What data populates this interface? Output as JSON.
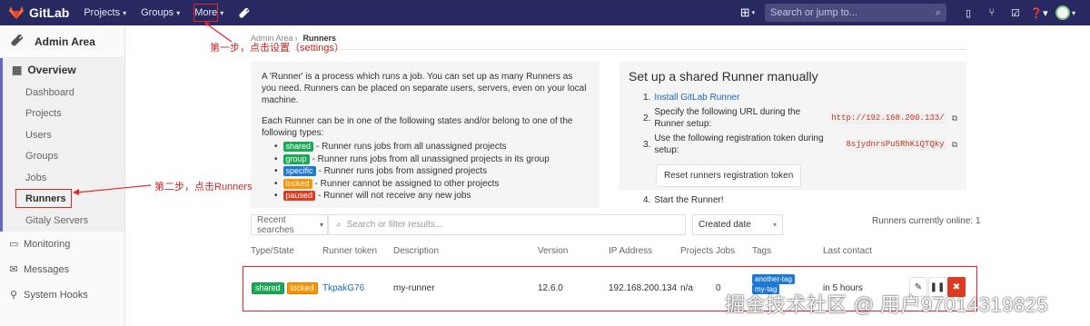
{
  "topnav": {
    "brand": "GitLab",
    "links": [
      "Projects",
      "Groups",
      "More"
    ],
    "search_placeholder": "Search or jump to...",
    "icons": [
      "wrench-icon",
      "plus-icon",
      "search-icon",
      "todo-sidebar-icon",
      "merge-request-icon",
      "issues-icon",
      "help-icon",
      "avatar"
    ]
  },
  "sidebar": {
    "header": "Admin Area",
    "overview": "Overview",
    "sub_items": [
      "Dashboard",
      "Projects",
      "Users",
      "Groups",
      "Jobs",
      "Runners",
      "Gitaly Servers"
    ],
    "active": "Runners",
    "items": [
      "Monitoring",
      "Messages",
      "System Hooks"
    ]
  },
  "breadcrumb": {
    "parent": "Admin Area",
    "current": "Runners"
  },
  "info": {
    "p1": "A 'Runner' is a process which runs a job. You can set up as many Runners as you need. Runners can be placed on separate users, servers, even on your local machine.",
    "p2": "Each Runner can be in one of the following states and/or belong to one of the following types:",
    "states": [
      {
        "tag": "shared",
        "text": "- Runner runs jobs from all unassigned projects",
        "color": "#1aaa55"
      },
      {
        "tag": "group",
        "text": "- Runner runs jobs from all unassigned projects in its group",
        "color": "#1aaa55"
      },
      {
        "tag": "specific",
        "text": "- Runner runs jobs from assigned projects",
        "color": "#1f78d1"
      },
      {
        "tag": "locked",
        "text": "- Runner cannot be assigned to other projects",
        "color": "#fc9403"
      },
      {
        "tag": "paused",
        "text": "- Runner will not receive any new jobs",
        "color": "#db3b21"
      }
    ]
  },
  "setup": {
    "title": "Set up a shared Runner manually",
    "step1_num": "1.",
    "step1_link": "Install GitLab Runner",
    "step2_num": "2.",
    "step2_text": "Specify the following URL during the Runner setup:",
    "url": "http://192.168.200.133/",
    "step3_num": "3.",
    "step3_text": "Use the following registration token during setup:",
    "token": "8sjydnrsPu5RhKiQTQky",
    "reset_label": "Reset runners registration token",
    "step4_num": "4.",
    "step4_text": "Start the Runner!"
  },
  "filter": {
    "recent": "Recent searches",
    "placeholder": "Search or filter results...",
    "sort": "Created date",
    "online": "Runners currently online: 1"
  },
  "table": {
    "headers": [
      "Type/State",
      "Runner token",
      "Description",
      "Version",
      "IP Address",
      "Projects",
      "Jobs",
      "Tags",
      "Last contact"
    ],
    "row": {
      "type_tags": [
        "shared",
        "locked"
      ],
      "token": "TkpakG76",
      "description": "my-runner",
      "version": "12.6.0",
      "ip": "192.168.200.134",
      "projects": "n/a",
      "jobs": "0",
      "tags": [
        "another-tag",
        "my-tag"
      ],
      "last_contact": "in 5 hours"
    }
  },
  "annotations": {
    "step1": "第一步，点击设置（settings）",
    "step2": "第二步，点击Runners"
  },
  "watermark": "掘金技术社区 @ 用户97014319825"
}
